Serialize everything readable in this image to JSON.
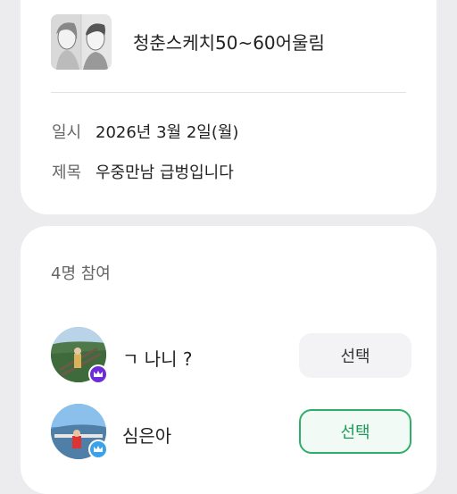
{
  "group": {
    "name": "청춘스케치50~60어울림",
    "thumbnail_icon": "sketch-portrait-image"
  },
  "info": {
    "date_label": "일시",
    "date_value": "2026년 3월 2일(월)",
    "title_label": "제목",
    "title_value": "우중만남 급벙입니다"
  },
  "participants": {
    "count_text": "4명 참여",
    "members": [
      {
        "name": "ㄱ 나니 ?",
        "select_label": "선택",
        "badge_icon": "crown-icon",
        "badge_color": "#6d2bd9",
        "selected": false
      },
      {
        "name": "심은아",
        "select_label": "선택",
        "badge_icon": "crown-icon",
        "badge_color": "#3aa2e8",
        "selected": true
      }
    ]
  },
  "colors": {
    "accent_green": "#2fae6a",
    "leader_purple": "#6d2bd9",
    "manager_blue": "#3aa2e8"
  }
}
